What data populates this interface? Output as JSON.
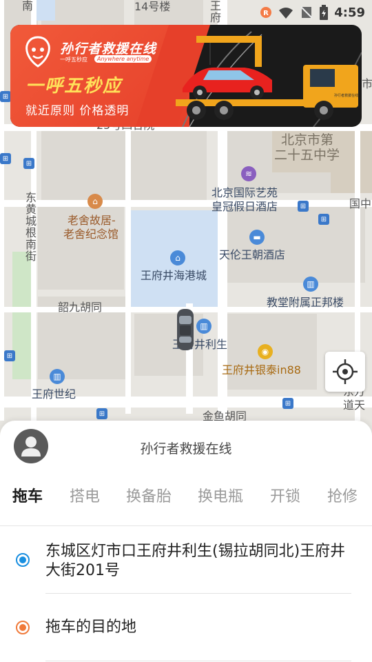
{
  "status_bar": {
    "time": "4:59",
    "icons": [
      "app-badge-icon",
      "wifi-icon",
      "no-sim-icon",
      "battery-icon"
    ]
  },
  "banner": {
    "brand": "孙行者救援在线",
    "brand_sub": "一呼五秒应",
    "brand_tag": "Anywhere anytime",
    "slogan": "一呼五秒应",
    "sub": "就近原则 价格透明",
    "truck_sign": "孙行者救援在线"
  },
  "map": {
    "labels": {
      "nan": "南",
      "jie": "街",
      "floor14": "14号楼",
      "wang": "王",
      "fu": "府",
      "lou": "楼",
      "guoshi": "国",
      "street25": "25号四合院",
      "middle_school_1": "北京市第",
      "middle_school_2": "二十五中学",
      "art_garden_1": "北京国际艺苑",
      "art_garden_2": "皇冠假日酒店",
      "guo_right": "国中",
      "dongcheng_street": "东黄城根南街",
      "laoshe_1": "老舍故居-",
      "laoshe_2": "老舍纪念馆",
      "tianlun": "天伦王朝酒店",
      "haigang": "王府井海港城",
      "church": "教堂附属正邦楼",
      "shaojiu": "韶九胡同",
      "lishen": "王府井利生",
      "yintai": "王府井银泰in88",
      "shiji": "王府世纪",
      "jinyu": "金鱼胡同",
      "dongfang_1": "东方",
      "dongfang_2": "道天",
      "shi": "市"
    }
  },
  "sheet": {
    "title": "孙行者救援在线",
    "tabs": [
      "拖车",
      "搭电",
      "换备胎",
      "换电瓶",
      "开锁",
      "抢修"
    ],
    "active_tab": "拖车",
    "origin": "东城区灯市口王府井利生(锡拉胡同北)王府井大街201号",
    "destination_placeholder": "拖车的目的地"
  },
  "colors": {
    "origin_dot": "#1a8fe0",
    "destination_dot": "#f07a3a",
    "banner_red": "#e6402a",
    "slogan_yellow": "#ffe25a"
  }
}
